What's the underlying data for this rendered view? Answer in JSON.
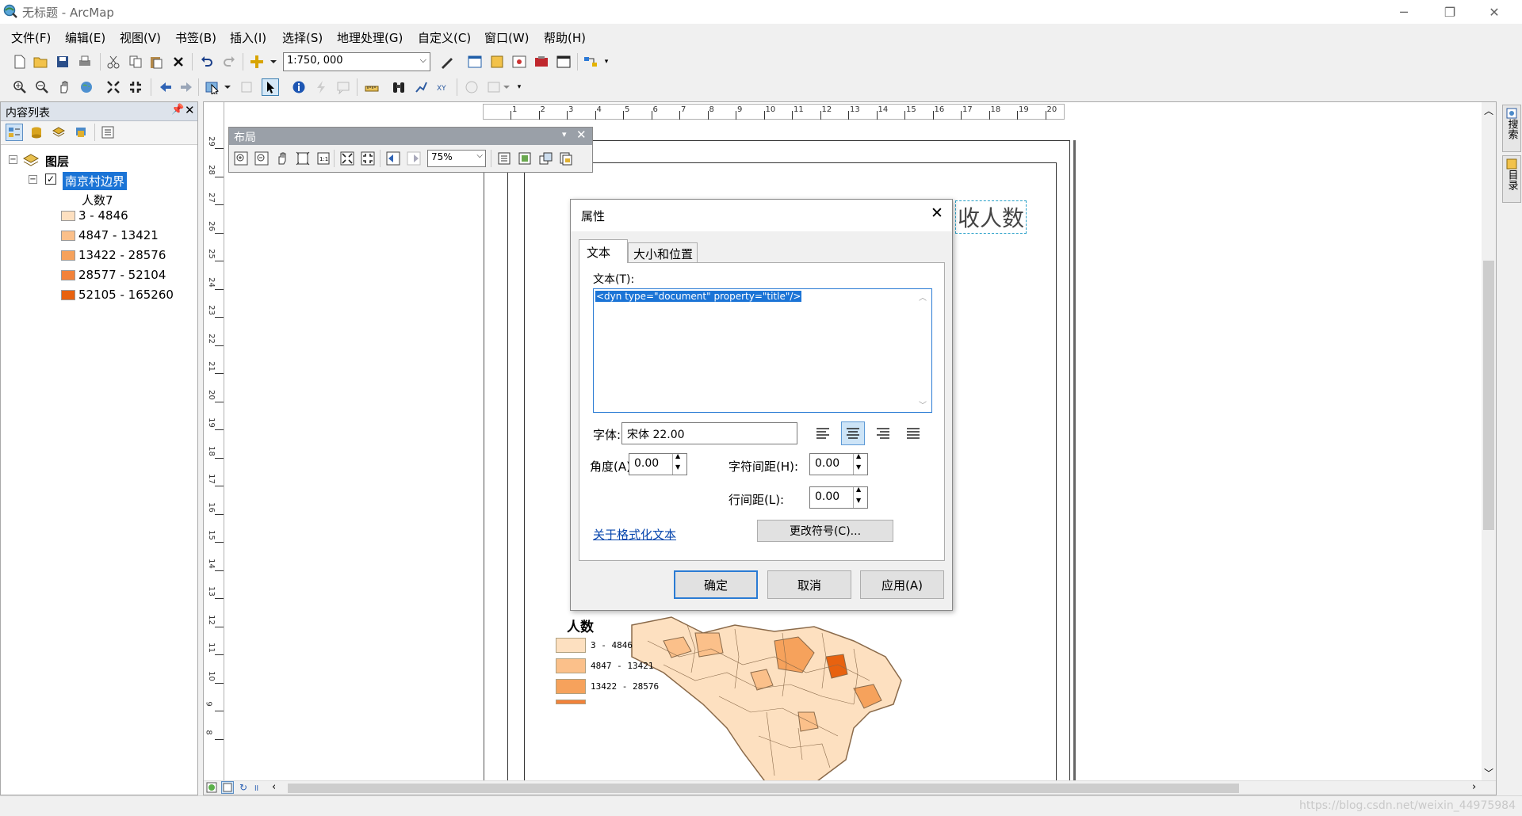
{
  "window": {
    "title": "无标题 - ArcMap"
  },
  "menu": [
    "文件(F)",
    "编辑(E)",
    "视图(V)",
    "书签(B)",
    "插入(I)",
    "选择(S)",
    "地理处理(G)",
    "自定义(C)",
    "窗口(W)",
    "帮助(H)"
  ],
  "standard_toolbar": {
    "scale_value": "1:750, 000"
  },
  "toc": {
    "title": "内容列表",
    "root_label": "图层",
    "layer_name": "南京村边界",
    "field_name": "人数7",
    "classes": [
      {
        "label": "3 - 4846",
        "color": "#fde0c0"
      },
      {
        "label": "4847 - 13421",
        "color": "#fbc08a"
      },
      {
        "label": "13422 - 28576",
        "color": "#f6a25c"
      },
      {
        "label": "28577 - 52104",
        "color": "#f2823a"
      },
      {
        "label": "52105 - 165260",
        "color": "#e8620f"
      }
    ]
  },
  "rulers": {
    "horizontal": [
      "1",
      "2",
      "3",
      "4",
      "5",
      "6",
      "7",
      "8",
      "9",
      "10",
      "11",
      "12",
      "13",
      "14",
      "15",
      "16",
      "17",
      "18",
      "19",
      "20"
    ],
    "vertical": [
      "29",
      "28",
      "27",
      "26",
      "25",
      "24",
      "23",
      "22",
      "21",
      "20",
      "19",
      "18",
      "17",
      "16",
      "15",
      "14",
      "13",
      "12",
      "11",
      "10",
      "9",
      "8"
    ]
  },
  "layout_toolbar": {
    "title": "布局",
    "zoom_value": "75%"
  },
  "page": {
    "title_fragment": "收人数",
    "legend_title": "人数",
    "legend_items": [
      "3 - 4846",
      "4847 - 13421",
      "13422 - 28576"
    ]
  },
  "dialog": {
    "title": "属性",
    "tabs": [
      "文本",
      "大小和位置"
    ],
    "text_label": "文本(T):",
    "text_value": "<dyn type=\"document\" property=\"title\"/>",
    "font_label": "字体:",
    "font_value": "宋体 22.00",
    "angle_label": "角度(A):",
    "angle_value": "0.00",
    "char_spacing_label": "字符间距(H):",
    "char_spacing_value": "0.00",
    "line_spacing_label": "行间距(L):",
    "line_spacing_value": "0.00",
    "format_link": "关于格式化文本",
    "change_symbol": "更改符号(C)...",
    "ok": "确定",
    "cancel": "取消",
    "apply": "应用(A)"
  },
  "right_dock": {
    "tabs": [
      "搜索",
      "目录"
    ]
  },
  "status": {
    "watermark": "https://blog.csdn.net/weixin_44975984"
  }
}
